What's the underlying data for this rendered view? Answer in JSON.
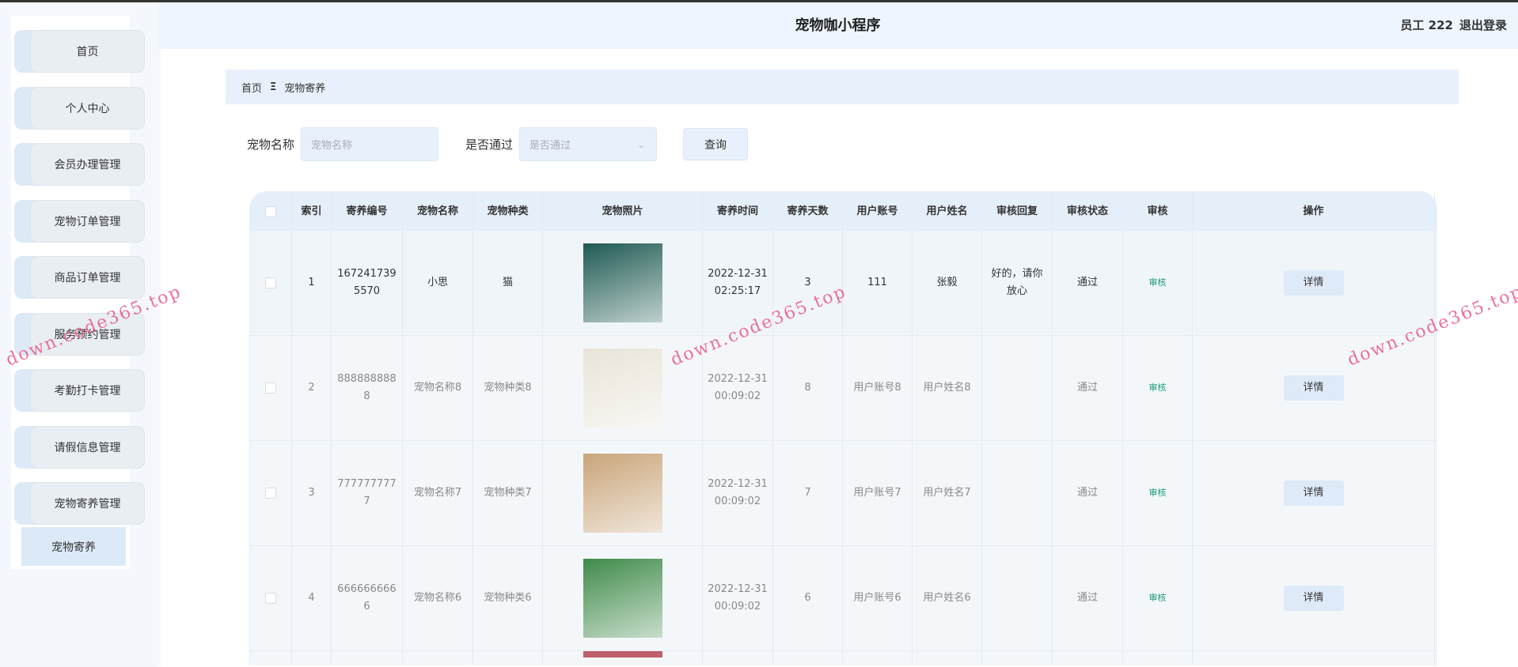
{
  "header": {
    "title": "宠物咖小程序",
    "user": "员工 222",
    "logout": "退出登录"
  },
  "sidebar": {
    "items": [
      "首页",
      "个人中心",
      "会员办理管理",
      "宠物订单管理",
      "商品订单管理",
      "服务预约管理",
      "考勤打卡管理",
      "请假信息管理",
      "宠物寄养管理"
    ],
    "active_sub": "宠物寄养"
  },
  "breadcrumb": {
    "home": "首页",
    "sep": "Ξ",
    "current": "宠物寄养"
  },
  "search": {
    "name_label": "宠物名称",
    "name_placeholder": "宠物名称",
    "pass_label": "是否通过",
    "pass_placeholder": "是否通过",
    "query": "查询"
  },
  "table": {
    "headers": [
      "索引",
      "寄养编号",
      "宠物名称",
      "宠物种类",
      "宠物照片",
      "寄养时间",
      "寄养天数",
      "用户账号",
      "用户姓名",
      "审核回复",
      "审核状态",
      "审核",
      "操作"
    ],
    "rows": [
      {
        "index": "1",
        "code": "1672417395570",
        "name": "小思",
        "type": "猫",
        "time": "2022-12-31 02:25:17",
        "days": "3",
        "account": "111",
        "user": "张毅",
        "reply": "好的，请你放心",
        "status": "通过",
        "audit": "审核",
        "action": "详情",
        "photo_color": "#1f5a52"
      },
      {
        "index": "2",
        "code": "8888888888",
        "name": "宠物名称8",
        "type": "宠物种类8",
        "time": "2022-12-31 00:09:02",
        "days": "8",
        "account": "用户账号8",
        "user": "用户姓名8",
        "reply": "",
        "status": "通过",
        "audit": "审核",
        "action": "详情",
        "photo_color": "#e9e4d8"
      },
      {
        "index": "3",
        "code": "7777777777",
        "name": "宠物名称7",
        "type": "宠物种类7",
        "time": "2022-12-31 00:09:02",
        "days": "7",
        "account": "用户账号7",
        "user": "用户姓名7",
        "reply": "",
        "status": "通过",
        "audit": "审核",
        "action": "详情",
        "photo_color": "#c9a57a"
      },
      {
        "index": "4",
        "code": "6666666666",
        "name": "宠物名称6",
        "type": "宠物种类6",
        "time": "2022-12-31 00:09:02",
        "days": "6",
        "account": "用户账号6",
        "user": "用户姓名6",
        "reply": "",
        "status": "通过",
        "audit": "审核",
        "action": "详情",
        "photo_color": "#3f8a4a"
      }
    ]
  },
  "watermark": "down.code365.top",
  "colors": {
    "accent": "#e5effa",
    "audit": "#1a9a7a"
  }
}
